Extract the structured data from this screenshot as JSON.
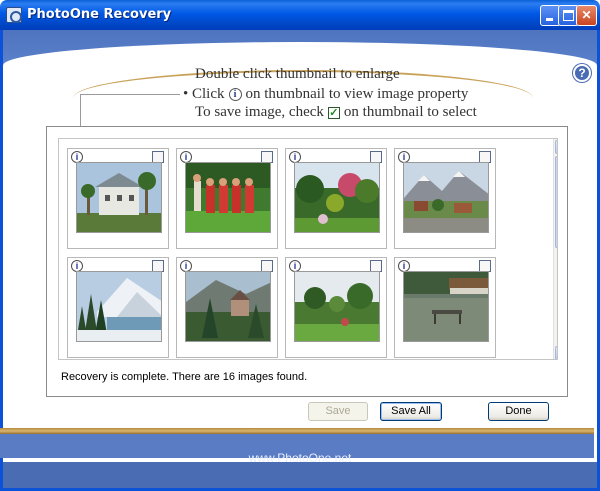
{
  "window": {
    "title": "PhotoOne Recovery",
    "help_label": "?"
  },
  "instructions": {
    "line1": "Double click thumbnail to enlarge",
    "line2_prefix": "• Click",
    "line2_suffix": "on thumbnail to view image property",
    "line3_prefix": "To save image, check",
    "line3_suffix": "on thumbnail to select",
    "info_glyph": "i",
    "check_glyph": "✓"
  },
  "thumbnails": [
    {
      "icon": "info-icon",
      "checked": false,
      "scene": "house-with-palms"
    },
    {
      "icon": "info-icon",
      "checked": false,
      "scene": "people-in-red-dresses"
    },
    {
      "icon": "info-icon",
      "checked": false,
      "scene": "garden-trees"
    },
    {
      "icon": "info-icon",
      "checked": false,
      "scene": "mountain-village"
    },
    {
      "icon": "info-icon",
      "checked": false,
      "scene": "snowy-mountain-lake"
    },
    {
      "icon": "info-icon",
      "checked": false,
      "scene": "castle-forest"
    },
    {
      "icon": "info-icon",
      "checked": false,
      "scene": "park-garden"
    },
    {
      "icon": "info-icon",
      "checked": false,
      "scene": "pier-on-lake"
    }
  ],
  "status": "Recovery is complete. There are 16 images found.",
  "buttons": {
    "save": "Save",
    "save_all": "Save All",
    "done": "Done"
  },
  "footer": "www.PhotoOne.net",
  "colors": {
    "title_bar": "#0058e6",
    "frame_blue": "#4a6cb3",
    "gold": "#c9a25a"
  }
}
